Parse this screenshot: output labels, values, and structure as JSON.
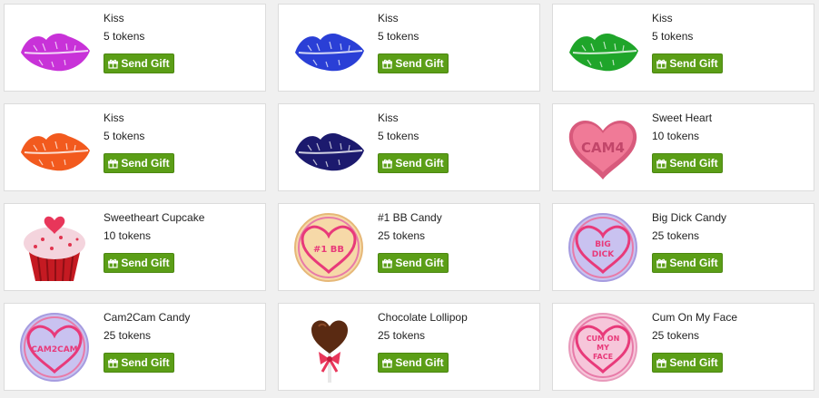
{
  "gifts": [
    {
      "name": "Kiss",
      "price": "5 tokens",
      "button": "Send Gift",
      "icon": "purple-lips-icon",
      "color": "#c832d8"
    },
    {
      "name": "Kiss",
      "price": "5 tokens",
      "button": "Send Gift",
      "icon": "blue-lips-icon",
      "color": "#2a3fd6"
    },
    {
      "name": "Kiss",
      "price": "5 tokens",
      "button": "Send Gift",
      "icon": "green-lips-icon",
      "color": "#1fa52a"
    },
    {
      "name": "Kiss",
      "price": "5 tokens",
      "button": "Send Gift",
      "icon": "orange-lips-icon",
      "color": "#f25a1e"
    },
    {
      "name": "Kiss",
      "price": "5 tokens",
      "button": "Send Gift",
      "icon": "navy-lips-icon",
      "color": "#1c1a6e"
    },
    {
      "name": "Sweet Heart",
      "price": "10 tokens",
      "button": "Send Gift",
      "icon": "candy-heart-icon",
      "label": "CAM4",
      "color": "#f07a97"
    },
    {
      "name": "Sweetheart Cupcake",
      "price": "10 tokens",
      "button": "Send Gift",
      "icon": "cupcake-icon",
      "color": "#c51a22"
    },
    {
      "name": "#1 BB Candy",
      "price": "25 tokens",
      "button": "Send Gift",
      "icon": "bb-candy-icon",
      "label": "#1 BB",
      "color": "#f3c88a"
    },
    {
      "name": "Big Dick Candy",
      "price": "25 tokens",
      "button": "Send Gift",
      "icon": "big-dick-candy-icon",
      "label": "BIG DICK",
      "color": "#b8b0ea"
    },
    {
      "name": "Cam2Cam Candy",
      "price": "25 tokens",
      "button": "Send Gift",
      "icon": "cam2cam-candy-icon",
      "label": "CAM2CAM",
      "color": "#b8b0ea"
    },
    {
      "name": "Chocolate Lollipop",
      "price": "25 tokens",
      "button": "Send Gift",
      "icon": "chocolate-lollipop-icon",
      "color": "#5a2a12"
    },
    {
      "name": "Cum On My Face",
      "price": "25 tokens",
      "button": "Send Gift",
      "icon": "cum-on-my-face-candy-icon",
      "label": "CUM ON MY FACE",
      "color": "#f3b5d0"
    }
  ],
  "colors": {
    "button_bg": "#5b9e17",
    "card_bg": "#ffffff",
    "page_bg": "#f0f0f0"
  }
}
